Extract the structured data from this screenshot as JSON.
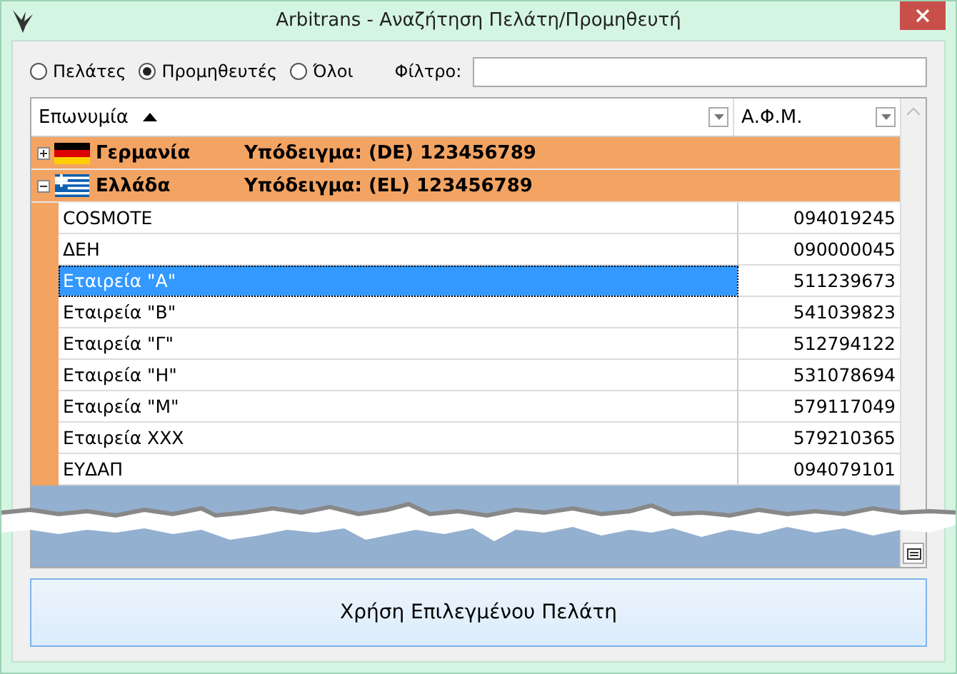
{
  "window": {
    "title": "Arbitrans - Αναζήτηση Πελάτη/Προμηθευτή"
  },
  "filter_options": [
    {
      "label": "Πελάτες",
      "selected": false
    },
    {
      "label": "Προμηθευτές",
      "selected": true
    },
    {
      "label": "Όλοι",
      "selected": false
    }
  ],
  "filter": {
    "label": "Φίλτρο:"
  },
  "table": {
    "columns": [
      {
        "label": "Επωνυμία",
        "sorted": true
      },
      {
        "label": "Α.Φ.Μ."
      }
    ],
    "groups": [
      {
        "kind": "de",
        "country": "Γερμανία",
        "example": "Υπόδειγμα: (DE) 123456789",
        "expanded": false
      },
      {
        "kind": "gr",
        "country": "Ελλάδα",
        "example": "Υπόδειγμα: (EL) 123456789",
        "expanded": true,
        "rows": [
          {
            "name": "COSMOTE",
            "afm": "094019245",
            "selected": false
          },
          {
            "name": "ΔΕΗ",
            "afm": "090000045",
            "selected": false
          },
          {
            "name": "Εταιρεία \"Α\"",
            "afm": "511239673",
            "selected": true
          },
          {
            "name": "Εταιρεία \"B\"",
            "afm": "541039823",
            "selected": false
          },
          {
            "name": "Εταιρεία \"Γ\"",
            "afm": "512794122",
            "selected": false
          },
          {
            "name": "Εταιρεία \"Η\"",
            "afm": "531078694",
            "selected": false
          },
          {
            "name": "Εταιρεία \"Μ\"",
            "afm": "579117049",
            "selected": false
          },
          {
            "name": "Εταιρεία ΧΧΧ",
            "afm": "579210365",
            "selected": false
          },
          {
            "name": "ΕΥΔΑΠ",
            "afm": "094079101",
            "selected": false
          }
        ]
      }
    ]
  },
  "button": {
    "label": "Χρήση Επιλεγμένου Πελάτη"
  }
}
